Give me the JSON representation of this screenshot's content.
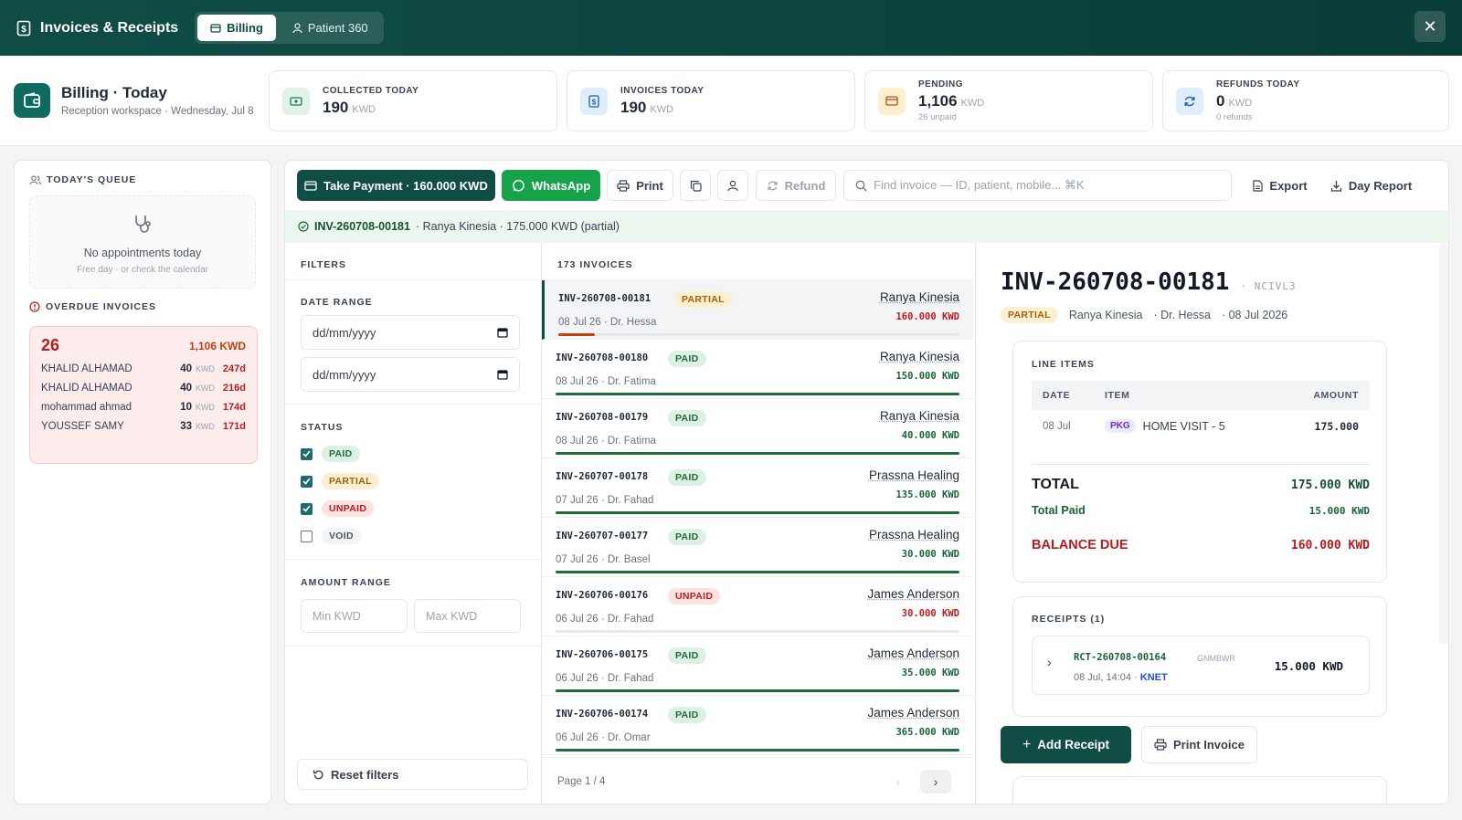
{
  "topbar": {
    "title": "Invoices & Receipts",
    "tabs": [
      {
        "label": "Billing"
      },
      {
        "label": "Patient 360"
      }
    ],
    "close_label": "✕"
  },
  "header": {
    "title": "Billing · Today",
    "subtitle": "Reception workspace · Wednesday, Jul 8"
  },
  "stats": [
    {
      "label": "COLLECTED TODAY",
      "value": "190",
      "unit": "KWD",
      "note": ""
    },
    {
      "label": "INVOICES TODAY",
      "value": "190",
      "unit": "KWD",
      "note": ""
    },
    {
      "label": "PENDING",
      "value": "1,106",
      "unit": "KWD",
      "note": "26 unpaid"
    },
    {
      "label": "REFUNDS TODAY",
      "value": "0",
      "unit": "KWD",
      "note": "0 refunds"
    }
  ],
  "queue": {
    "title": "TODAY'S QUEUE",
    "empty_title": "No appointments today",
    "empty_sub": "Free day · or check the calendar"
  },
  "overdue": {
    "title": "OVERDUE INVOICES",
    "count": "26",
    "total": "1,106 KWD",
    "unit": "KWD",
    "rows": [
      {
        "name": "KHALID ALHAMAD",
        "amount": "40",
        "days": "247d"
      },
      {
        "name": "KHALID ALHAMAD",
        "amount": "40",
        "days": "216d"
      },
      {
        "name": "mohammad ahmad",
        "amount": "10",
        "days": "174d"
      },
      {
        "name": "YOUSSEF SAMY",
        "amount": "33",
        "days": "171d"
      }
    ]
  },
  "toolbar": {
    "take_payment": "Take Payment · 160.000 KWD",
    "whatsapp": "WhatsApp",
    "print": "Print",
    "refund": "Refund",
    "search_placeholder": "Find invoice — ID, patient, mobile...  ⌘K",
    "export": "Export",
    "day_report": "Day Report"
  },
  "banner": {
    "invoice_id": "INV-260708-00181",
    "rest": "· Ranya Kinesia · 175.000 KWD (partial)"
  },
  "filters": {
    "title": "FILTERS",
    "date_range": "DATE RANGE",
    "date_placeholder": "dd/mm/yyyy",
    "status": "STATUS",
    "statuses": [
      {
        "label": "PAID",
        "checked": true
      },
      {
        "label": "PARTIAL",
        "checked": true
      },
      {
        "label": "UNPAID",
        "checked": true
      },
      {
        "label": "VOID",
        "checked": false
      }
    ],
    "amount_range": "AMOUNT RANGE",
    "min_placeholder": "Min KWD",
    "max_placeholder": "Max KWD",
    "reset": "Reset filters"
  },
  "list": {
    "count_label": "173 INVOICES",
    "page": "Page 1 / 4",
    "invoices": [
      {
        "id": "INV-260708-00181",
        "status": "PARTIAL",
        "date": "08 Jul 26 · Dr. Hessa",
        "patient": "Ranya Kinesia",
        "amount": "160.000 KWD",
        "paid_fraction": 0.09
      },
      {
        "id": "INV-260708-00180",
        "status": "PAID",
        "date": "08 Jul 26 · Dr. Fatima",
        "patient": "Ranya Kinesia",
        "amount": "150.000 KWD",
        "paid_fraction": 1
      },
      {
        "id": "INV-260708-00179",
        "status": "PAID",
        "date": "08 Jul 26 · Dr. Fatima",
        "patient": "Ranya Kinesia",
        "amount": "40.000 KWD",
        "paid_fraction": 1
      },
      {
        "id": "INV-260707-00178",
        "status": "PAID",
        "date": "07 Jul 26 · Dr. Fahad",
        "patient": "Prassna Healing",
        "amount": "135.000 KWD",
        "paid_fraction": 1
      },
      {
        "id": "INV-260707-00177",
        "status": "PAID",
        "date": "07 Jul 26 · Dr. Basel",
        "patient": "Prassna Healing",
        "amount": "30.000 KWD",
        "paid_fraction": 1
      },
      {
        "id": "INV-260706-00176",
        "status": "UNPAID",
        "date": "06 Jul 26 · Dr. Fahad",
        "patient": "James Anderson",
        "amount": "30.000 KWD",
        "paid_fraction": 0
      },
      {
        "id": "INV-260706-00175",
        "status": "PAID",
        "date": "06 Jul 26 · Dr. Fahad",
        "patient": "James Anderson",
        "amount": "35.000 KWD",
        "paid_fraction": 1
      },
      {
        "id": "INV-260706-00174",
        "status": "PAID",
        "date": "06 Jul 26 · Dr. Omar",
        "patient": "James Anderson",
        "amount": "365.000 KWD",
        "paid_fraction": 1
      }
    ]
  },
  "detail": {
    "invoice_id": "INV-260708-00181",
    "code": "NCIVL3",
    "status": "PARTIAL",
    "patient": "Ranya Kinesia",
    "doctor": "· Dr. Hessa",
    "date": "· 08 Jul 2026",
    "line_items_title": "LINE ITEMS",
    "columns": [
      "DATE",
      "ITEM",
      "AMOUNT"
    ],
    "items": [
      {
        "date": "08 Jul",
        "tag": "PKG",
        "item": "HOME VISIT - 5",
        "amount": "175.000"
      }
    ],
    "total_label": "TOTAL",
    "total_value": "175.000 KWD",
    "paid_label": "Total Paid",
    "paid_value": "15.000 KWD",
    "balance_label": "BALANCE DUE",
    "balance_value": "160.000 KWD",
    "receipts_title": "RECEIPTS (1)",
    "receipt": {
      "id": "RCT-260708-00164",
      "code": "GNMBWR",
      "meta": "08 Jul, 14:04 ·",
      "method": "KNET",
      "amount": "15.000 KWD"
    },
    "add_receipt": "Add Receipt",
    "print_invoice": "Print Invoice"
  },
  "colors": {
    "brand": "#0f4d45",
    "whatsapp": "#16a34a",
    "paid": "#1f6b3a",
    "partial": "#c2410c",
    "unpaid": "#b91c1c"
  }
}
